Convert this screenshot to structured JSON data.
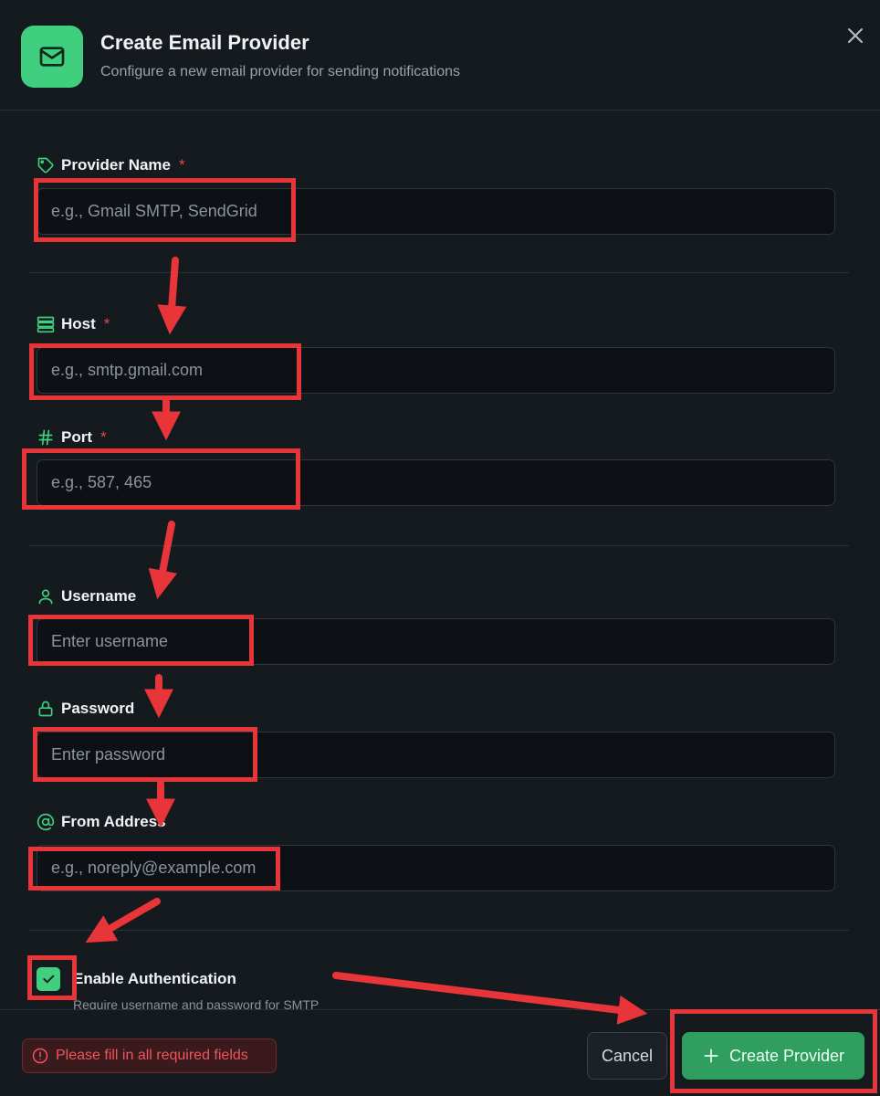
{
  "header": {
    "title": "Create Email Provider",
    "subtitle": "Configure a new email provider for sending notifications",
    "icon": "mail-icon"
  },
  "form": {
    "provider_name": {
      "label": "Provider Name",
      "required_mark": "*",
      "placeholder": "e.g., Gmail SMTP, SendGrid",
      "value": "",
      "icon": "tag-icon"
    },
    "host": {
      "label": "Host",
      "required_mark": "*",
      "placeholder": "e.g., smtp.gmail.com",
      "value": "",
      "icon": "server-icon"
    },
    "port": {
      "label": "Port",
      "required_mark": "*",
      "placeholder": "e.g., 587, 465",
      "value": "",
      "icon": "hash-icon"
    },
    "username": {
      "label": "Username",
      "placeholder": "Enter username",
      "value": "",
      "icon": "user-icon"
    },
    "password": {
      "label": "Password",
      "placeholder": "Enter password",
      "value": "",
      "icon": "lock-icon"
    },
    "from_address": {
      "label": "From Address",
      "placeholder": "e.g., noreply@example.com",
      "value": "",
      "icon": "at-sign-icon"
    },
    "enable_auth": {
      "label": "Enable Authentication",
      "description": "Require username and password for SMTP",
      "checked": true
    }
  },
  "footer": {
    "error_message": "Please fill in all required fields",
    "cancel_label": "Cancel",
    "create_label": "Create Provider"
  },
  "colors": {
    "background": "#151a1f",
    "accent_green": "#3fcf7e",
    "primary_button": "#2f9e5e",
    "error_red": "#f0555a",
    "annotation_red": "#e8353a"
  }
}
